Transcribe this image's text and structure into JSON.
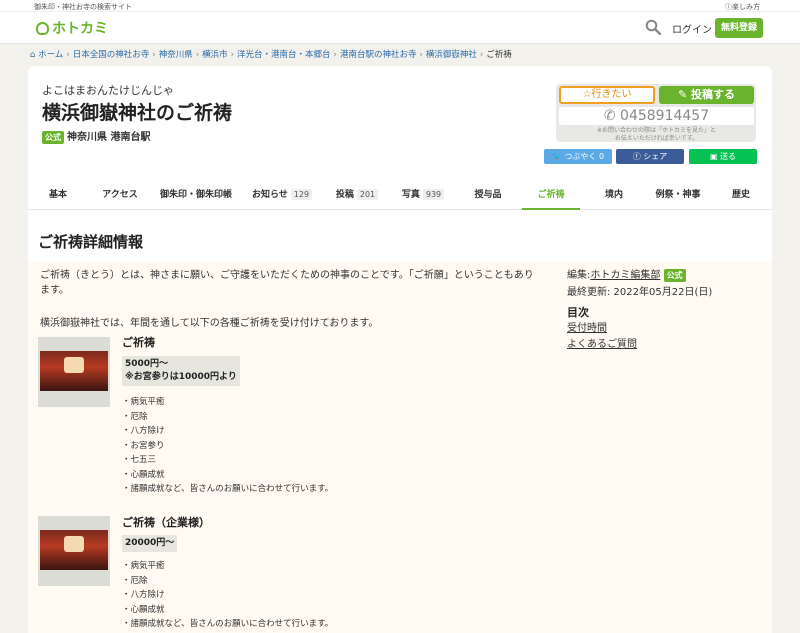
{
  "topbar": {
    "tagline": "御朱印・神社お寺の検索サイト",
    "help": "楽しみ方"
  },
  "header": {
    "logo": "ホトカミ",
    "login": "ログイン",
    "register": "無料登録"
  },
  "breadcrumb": [
    "ホーム",
    "日本全国の神社お寺",
    "神奈川県",
    "横浜市",
    "洋光台・港南台・本郷台",
    "港南台駅の神社お寺",
    "横浜御嶽神社",
    "ご祈祷"
  ],
  "shrine": {
    "kana": "よこはまおんたけじんじゃ",
    "title": "横浜御嶽神社のご祈祷",
    "official_badge": "公式",
    "location": "神奈川県 港南台駅"
  },
  "actions": {
    "want": "☆行きたい",
    "post": "投稿する",
    "phone": "0458914457",
    "phone_note_1": "※お問い合わせの際は「ホトカミを見た」と",
    "phone_note_2": "お伝えいただければ幸いです。",
    "tweet": "つぶやく 0",
    "share": "シェア",
    "line": "送る"
  },
  "tabs": [
    {
      "label": "基本",
      "count": ""
    },
    {
      "label": "アクセス",
      "count": ""
    },
    {
      "label": "御朱印・御朱印帳",
      "count": ""
    },
    {
      "label": "お知らせ",
      "count": "129"
    },
    {
      "label": "投稿",
      "count": "201"
    },
    {
      "label": "写真",
      "count": "939"
    },
    {
      "label": "授与品",
      "count": ""
    },
    {
      "label": "ご祈祷",
      "count": ""
    },
    {
      "label": "境内",
      "count": ""
    },
    {
      "label": "例祭・神事",
      "count": ""
    },
    {
      "label": "歴史",
      "count": ""
    }
  ],
  "section_title": "ご祈祷詳細情報",
  "intro_1": "ご祈祷（きとう）とは、神さまに願い、ご守護をいただくための神事のことです。「ご祈願」ということもあります。",
  "intro_2": "横浜御嶽神社では、年間を通して以下の各種ご祈祷を受け付けております。",
  "sidebar": {
    "editor_label": "編集:",
    "editor": "ホトカミ編集部",
    "editor_badge": "公式",
    "updated": "最終更新: 2022年05月22日(日)",
    "toc_title": "目次",
    "toc": [
      "受付時間",
      "よくあるご質問"
    ]
  },
  "items": [
    {
      "title": "ご祈祷",
      "price_1": "5000円〜",
      "price_2": "※お宮参りは10000円より",
      "list": [
        "・病気平癒",
        "・厄除",
        "・八方除け",
        "・お宮参り",
        "・七五三",
        "・心願成就",
        "・諸願成就など、皆さんのお願いに合わせて行います。"
      ]
    },
    {
      "title": "ご祈祷（企業様）",
      "price_1": "20000円〜",
      "list": [
        "・病気平癒",
        "・厄除",
        "・八方除け",
        "・心願成就",
        "・諸願成就など、皆さんのお願いに合わせて行います。"
      ]
    }
  ],
  "colors": {
    "brand_green": "#6ab42d",
    "want_orange": "#f0a01e"
  }
}
